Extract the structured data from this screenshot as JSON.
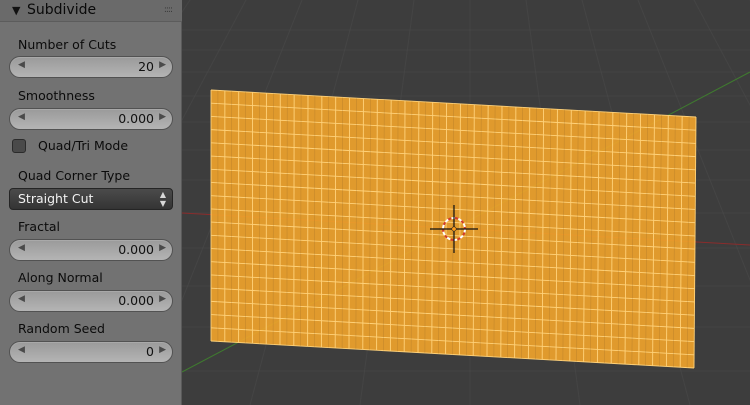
{
  "viewport": {
    "colors": {
      "background": "#3d3d3d",
      "grid": "#4a4a4a",
      "mesh_fill": "#f2a42b",
      "mesh_edges": "#ffd27a",
      "axis_x": "#8a2c2c",
      "axis_y": "#3f7a2f"
    },
    "mesh_cuts": 20,
    "cursor_icon": "3d-cursor-icon"
  },
  "panel": {
    "title": "Subdivide",
    "collapse_icon": "triangle-down-icon",
    "grip_icon": "drag-grip-icon",
    "number_of_cuts": {
      "label": "Number of Cuts",
      "value": "20"
    },
    "smoothness": {
      "label": "Smoothness",
      "value": "0.000"
    },
    "quad_tri": {
      "label": "Quad/Tri Mode",
      "checked": false
    },
    "quad_corner_type": {
      "label": "Quad Corner Type",
      "selected": "Straight Cut"
    },
    "fractal": {
      "label": "Fractal",
      "value": "0.000"
    },
    "along_normal": {
      "label": "Along Normal",
      "value": "0.000"
    },
    "random_seed": {
      "label": "Random Seed",
      "value": "0"
    }
  }
}
